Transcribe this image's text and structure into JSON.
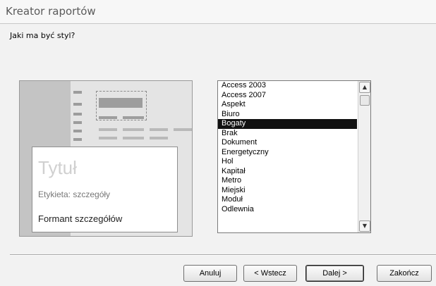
{
  "window": {
    "title": "Kreator raportów"
  },
  "question": "Jaki ma być styl?",
  "preview": {
    "title": "Tytuł",
    "label": "Etykieta: szczegóły",
    "control": "Formant szczegółów"
  },
  "styles": {
    "items": [
      "Access 2003",
      "Access 2007",
      "Aspekt",
      "Biuro",
      "Bogaty",
      "Brak",
      "Dokument",
      "Energetyczny",
      "Hol",
      "Kapitał",
      "Metro",
      "Miejski",
      "Moduł",
      "Odlewnia"
    ],
    "selected": "Bogaty"
  },
  "scrollbar": {
    "up_icon": "▲",
    "down_icon": "▼"
  },
  "buttons": {
    "cancel": "Anuluj",
    "back": "< Wstecz",
    "next": "Dalej >",
    "finish": "Zakończ"
  }
}
